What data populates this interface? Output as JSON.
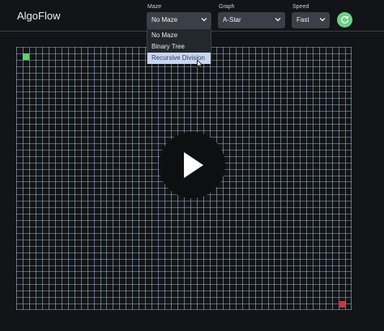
{
  "app": {
    "title": "AlgoFlow"
  },
  "controls": {
    "maze": {
      "label": "Maze",
      "value": "No Maze",
      "options": [
        "No Maze",
        "Binary Tree",
        "Recursive Division"
      ],
      "highlighted": "Recursive Division",
      "expanded": true
    },
    "graph": {
      "label": "Graph",
      "value": "A-Star"
    },
    "speed": {
      "label": "Speed",
      "value": "Fast"
    },
    "refresh_icon": "refresh-icon"
  },
  "grid": {
    "columns": 52,
    "rows": 41,
    "line_color": "#9fb3c8",
    "start_color": "#5ed36c",
    "end_color": "#c9373a"
  },
  "overlay": {
    "icon": "play-icon"
  },
  "colors": {
    "background": "#131417",
    "accent": "#6fcf86",
    "select_bg": "#3a3f48"
  }
}
